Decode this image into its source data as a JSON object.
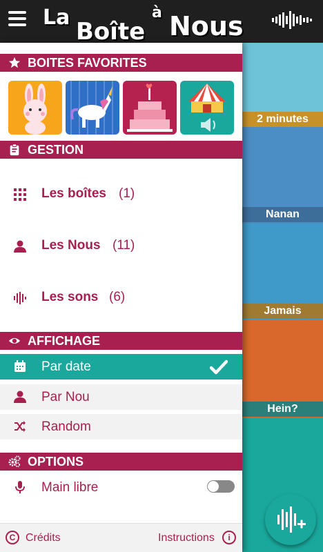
{
  "header": {
    "logo_words": [
      "La",
      "Boîte",
      "à",
      "Nous"
    ],
    "menu_icon": "hamburger-icon",
    "sounds_icon": "waveform-icon"
  },
  "favorites": {
    "title": "BOITES FAVORITES",
    "icon": "star-icon",
    "boxes": [
      {
        "name": "bunny",
        "color": "#f7a51b"
      },
      {
        "name": "unicorn",
        "color": "#2f6fc6"
      },
      {
        "name": "cake",
        "color": "#b5224f"
      },
      {
        "name": "circus",
        "color": "#1aa89c"
      }
    ]
  },
  "management": {
    "title": "GESTION",
    "icon": "clipboard-icon",
    "items": [
      {
        "label": "Les boîtes",
        "count": "(1)",
        "icon": "grid-icon"
      },
      {
        "label": "Les Nous",
        "count": "(11)",
        "icon": "person-icon"
      },
      {
        "label": "Les sons",
        "count": "(6)",
        "icon": "waveform-icon"
      }
    ]
  },
  "display": {
    "title": "AFFICHAGE",
    "icon": "eye-icon",
    "options": [
      {
        "label": "Par date",
        "icon": "calendar-icon",
        "selected": true
      },
      {
        "label": "Par Nou",
        "icon": "person-icon",
        "selected": false
      },
      {
        "label": "Random",
        "icon": "shuffle-icon",
        "selected": false
      }
    ]
  },
  "options": {
    "title": "OPTIONS",
    "icon": "gears-icon",
    "items": [
      {
        "label": "Main libre",
        "icon": "microphone-icon",
        "enabled": false
      }
    ]
  },
  "footer": {
    "credits": "Crédits",
    "instructions": "Instructions"
  },
  "characters": [
    {
      "label": "2 minutes",
      "band_color": "#c7912a"
    },
    {
      "label": "Nanan",
      "band_color": "#3d6d99"
    },
    {
      "label": "Jamais",
      "band_color": "#a07a30"
    },
    {
      "label": "Hein?",
      "band_color": "#2b7f7a"
    }
  ],
  "colors": {
    "accent": "#a8204f",
    "teal": "#1aa89c",
    "topbar": "#1f1f1f"
  }
}
